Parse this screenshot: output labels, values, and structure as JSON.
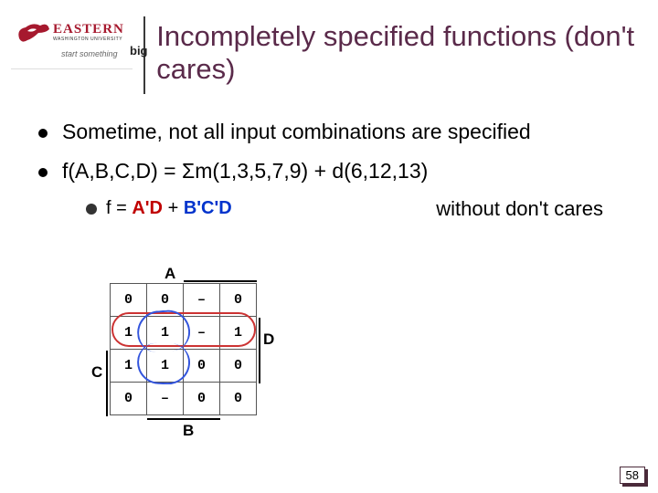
{
  "logo": {
    "name": "EASTERN",
    "subname": "WASHINGTON UNIVERSITY",
    "tagline": "start something",
    "tagline_big": "big"
  },
  "title": "Incompletely specified functions (don't cares)",
  "bullets": {
    "b1": "Sometime, not all input combinations are specified",
    "b2": "f(A,B,C,D) = Σm(1,3,5,7,9) + d(6,12,13)"
  },
  "sub": {
    "prefix": "f = ",
    "term1": "A'D",
    "plus": " + ",
    "term2": "B'C'D"
  },
  "without": "without don't cares",
  "kmap": {
    "labels": {
      "A": "A",
      "B": "B",
      "C": "C",
      "D": "D"
    },
    "rows": [
      [
        "0",
        "0",
        "–",
        "0"
      ],
      [
        "1",
        "1",
        "–",
        "1"
      ],
      [
        "1",
        "1",
        "0",
        "0"
      ],
      [
        "0",
        "–",
        "0",
        "0"
      ]
    ]
  },
  "slide_number": "58"
}
